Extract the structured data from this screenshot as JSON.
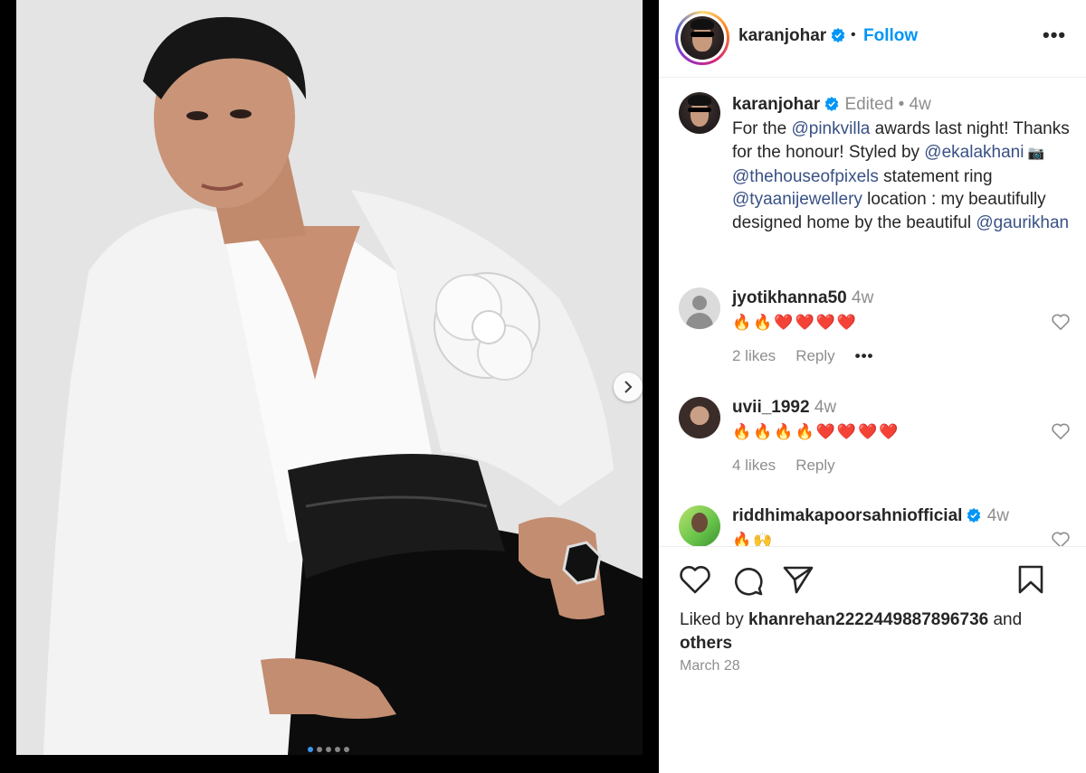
{
  "post": {
    "username": "karanjohar",
    "follow_label": "Follow",
    "header_separator": "•",
    "more_label": "•••"
  },
  "caption": {
    "username": "karanjohar",
    "edited": "Edited",
    "separator": "•",
    "time": "4w",
    "text_1": "For the ",
    "mention_1": "@pinkvilla",
    "text_2": " awards last night! Thanks for the honour! Styled by ",
    "mention_2": "@ekalakhani",
    "camera": " 📷 ",
    "mention_3": "@thehouseofpixels",
    "text_3": " statement ring ",
    "mention_4": "@tyaanijewellery",
    "text_4": " location : my beautifully designed home by the beautiful ",
    "mention_5": "@gaurikhan"
  },
  "comments": [
    {
      "username": "jyotikhanna50",
      "time": "4w",
      "emojis": "🔥🔥❤️❤️❤️❤️",
      "likes": "2 likes",
      "reply": "Reply",
      "more": "•••"
    },
    {
      "username": "uvii_1992",
      "time": "4w",
      "emojis": "🔥🔥🔥🔥❤️❤️❤️❤️",
      "likes": "4 likes",
      "reply": "Reply"
    },
    {
      "username": "riddhimakapoorsahniofficial",
      "time": "4w",
      "emojis": "🔥🙌"
    }
  ],
  "likes": {
    "prefix": "Liked by ",
    "user": "khanrehan2222449887896736",
    "mid": " and ",
    "others": "others"
  },
  "date": "March 28",
  "colors": {
    "link": "#0095f6",
    "mention": "#385185",
    "muted": "#8e8e8e",
    "text": "#262626",
    "verified": "#0095f6"
  },
  "icons": [
    "verified-badge-icon",
    "heart-icon",
    "comment-icon",
    "share-icon",
    "bookmark-icon",
    "more-icon",
    "chevron-right-icon"
  ]
}
